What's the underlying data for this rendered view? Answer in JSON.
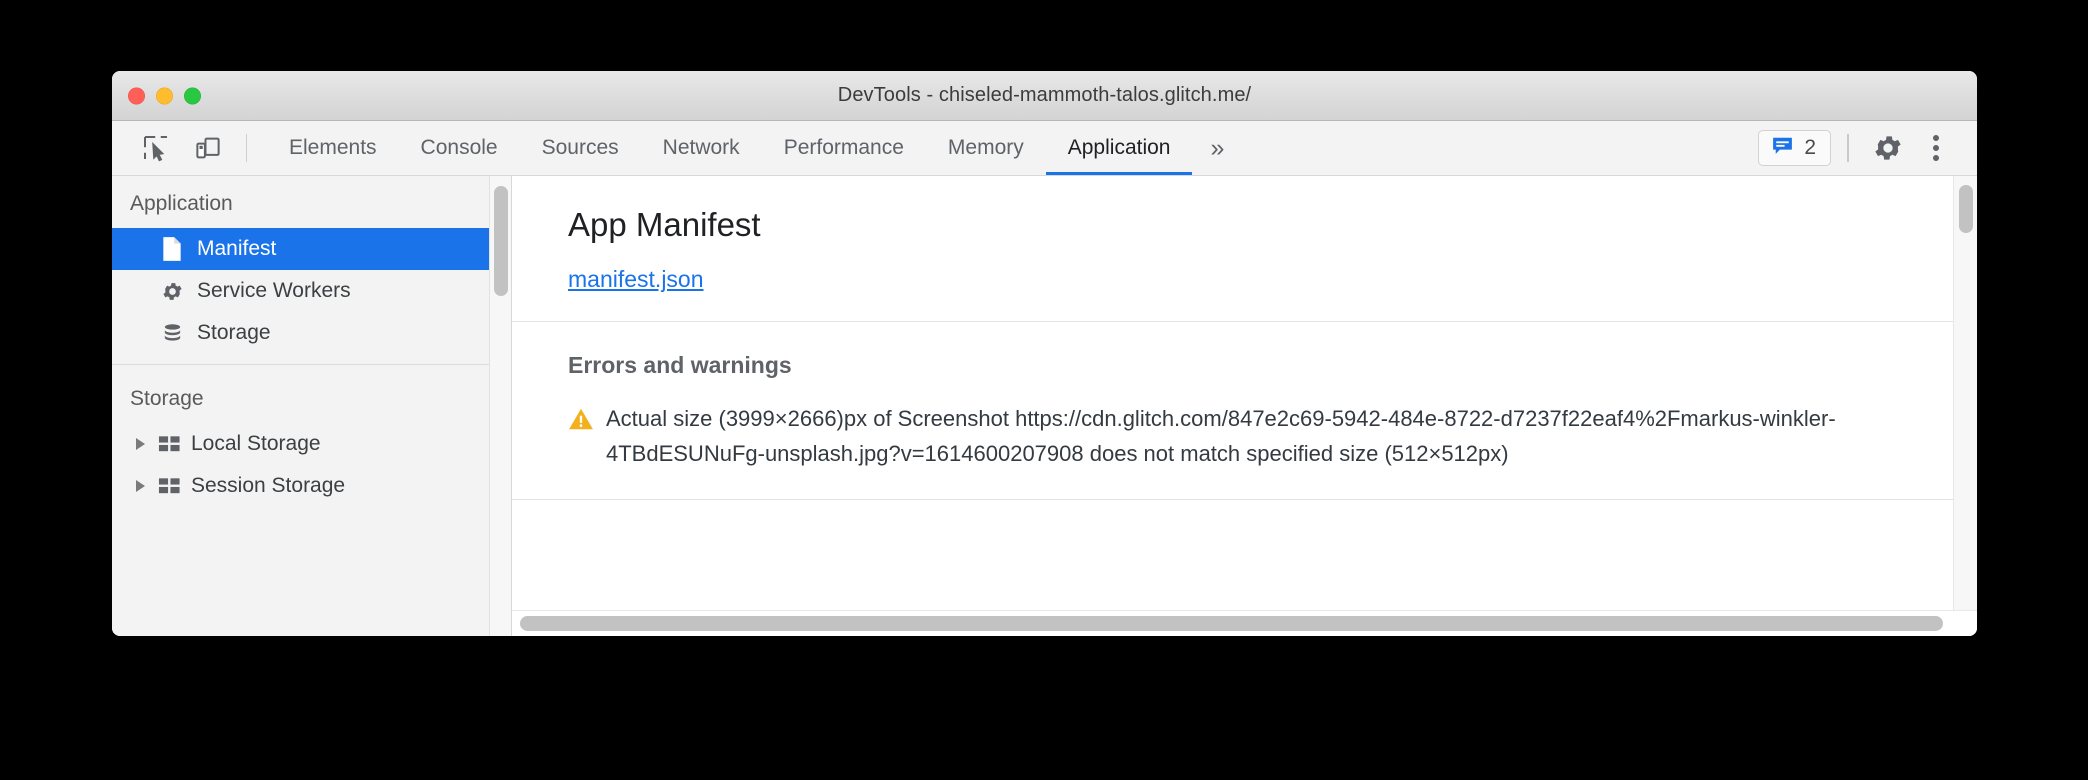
{
  "window": {
    "title": "DevTools - chiseled-mammoth-talos.glitch.me/",
    "traffic_lights": [
      "close-button",
      "minimize-button",
      "maximize-button"
    ]
  },
  "toolbar": {
    "inspect_icon": "inspect-cursor-icon",
    "device_icon": "device-toolbar-icon",
    "tabs": [
      {
        "label": "Elements",
        "active": false
      },
      {
        "label": "Console",
        "active": false
      },
      {
        "label": "Sources",
        "active": false
      },
      {
        "label": "Network",
        "active": false
      },
      {
        "label": "Performance",
        "active": false
      },
      {
        "label": "Memory",
        "active": false
      },
      {
        "label": "Application",
        "active": true
      }
    ],
    "more_tabs_label": "»",
    "issues": {
      "icon": "issues-message-icon",
      "count": "2"
    },
    "settings_icon": "gear-icon",
    "menu_icon": "kebab-menu-icon",
    "accent_color": "#1a73e8",
    "issue_icon_color": "#1a73e8"
  },
  "sidebar": {
    "sections": [
      {
        "title": "Application",
        "items": [
          {
            "label": "Manifest",
            "icon": "document-icon",
            "selected": true,
            "tree": false
          },
          {
            "label": "Service Workers",
            "icon": "gear-icon",
            "selected": false,
            "tree": false
          },
          {
            "label": "Storage",
            "icon": "database-icon",
            "selected": false,
            "tree": false
          }
        ]
      },
      {
        "title": "Storage",
        "items": [
          {
            "label": "Local Storage",
            "icon": "table-icon",
            "selected": false,
            "tree": true
          },
          {
            "label": "Session Storage",
            "icon": "table-icon",
            "selected": false,
            "tree": true
          }
        ]
      }
    ],
    "selected_bg": "#1a73e8"
  },
  "main": {
    "title": "App Manifest",
    "manifest_link": "manifest.json",
    "errors_heading": "Errors and warnings",
    "warning": {
      "icon": "warning-triangle-icon",
      "icon_color": "#f2b01e",
      "text": "Actual size (3999×2666)px of Screenshot https://cdn.glitch.com/847e2c69-5942-484e-8722-d7237f22eaf4%2Fmarkus-winkler-4TBdESUNuFg-unsplash.jpg?v=1614600207908 does not match specified size (512×512px)"
    }
  },
  "scrollbars": {
    "sidebar_vertical": "sidebar-scrollbar",
    "main_vertical": "main-vertical-scrollbar",
    "main_horizontal": "main-horizontal-scrollbar"
  }
}
